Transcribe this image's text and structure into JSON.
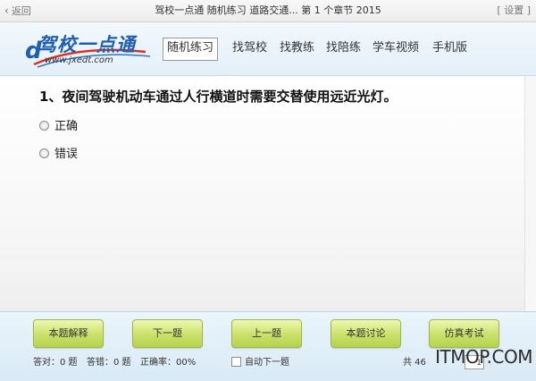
{
  "titlebar": {
    "back_label": "返回",
    "title": "驾校一点通 随机练习 道路交通... 第 1 个章节 2015",
    "settings_label": "[ 设置 ]"
  },
  "header": {
    "logo_text": "驾校一点通",
    "logo_url": "www.jxedt.com",
    "logo_icon": "d",
    "nav": [
      {
        "label": "随机练习",
        "active": true
      },
      {
        "label": "找驾校",
        "active": false
      },
      {
        "label": "找教练",
        "active": false
      },
      {
        "label": "找陪练",
        "active": false
      },
      {
        "label": "学车视频",
        "active": false
      },
      {
        "label": "手机版",
        "active": false
      }
    ]
  },
  "question": {
    "text": "1、夜间驾驶机动车通过人行横道时需要交替使用远近光灯。",
    "options": [
      {
        "label": "正确"
      },
      {
        "label": "错误"
      }
    ]
  },
  "footer": {
    "buttons": [
      {
        "label": "本题解释"
      },
      {
        "label": "下一题"
      },
      {
        "label": "上一题"
      },
      {
        "label": "本题讨论"
      },
      {
        "label": "仿真考试"
      }
    ],
    "correct_count": "答对：0 题",
    "wrong_count": "答错：0 题",
    "accuracy": "正确率：00%",
    "auto_next_label": "自动下一题",
    "total_prefix": "共 46",
    "page_select_value": "1"
  },
  "watermark": "ITMOP.COM",
  "colors": {
    "button_green": "#c9e06a",
    "brand_blue": "#1f5fb0",
    "header_bg": "#e3eff8"
  }
}
